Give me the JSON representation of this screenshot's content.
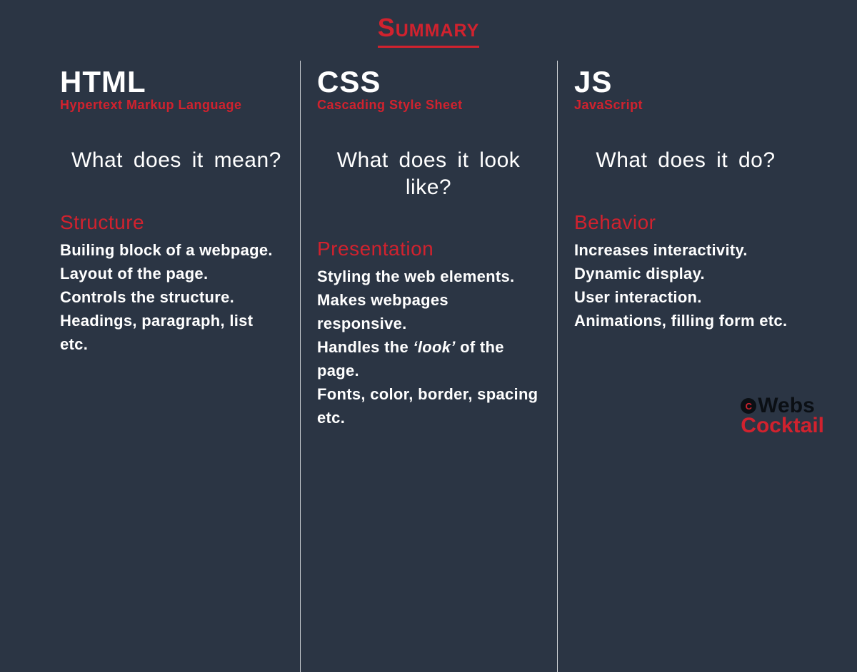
{
  "title": "Summary",
  "columns": [
    {
      "acronym": "HTML",
      "expansion": "Hypertext Markup Language",
      "question": "What does it mean?",
      "category": "Structure",
      "bullets": [
        "Builing block of a webpage.",
        "Layout of the page.",
        "Controls the structure.",
        "Headings, paragraph, list etc."
      ]
    },
    {
      "acronym": "CSS",
      "expansion": "Cascading Style Sheet",
      "question": "What does it look like?",
      "category": "Presentation",
      "bullets": [
        "Styling the web elements.",
        "Makes webpages responsive.",
        "Handles the 'look' of the page.",
        "Fonts, color, border, spacing etc."
      ]
    },
    {
      "acronym": "JS",
      "expansion": "JavaScript",
      "question": "What does it do?",
      "category": "Behavior",
      "bullets": [
        "Increases interactivity.",
        "Dynamic display.",
        "User interaction.",
        "Animations, filling form etc."
      ]
    }
  ],
  "logo": {
    "top": "Webs",
    "bottom": "Cocktail",
    "badge": "C"
  }
}
